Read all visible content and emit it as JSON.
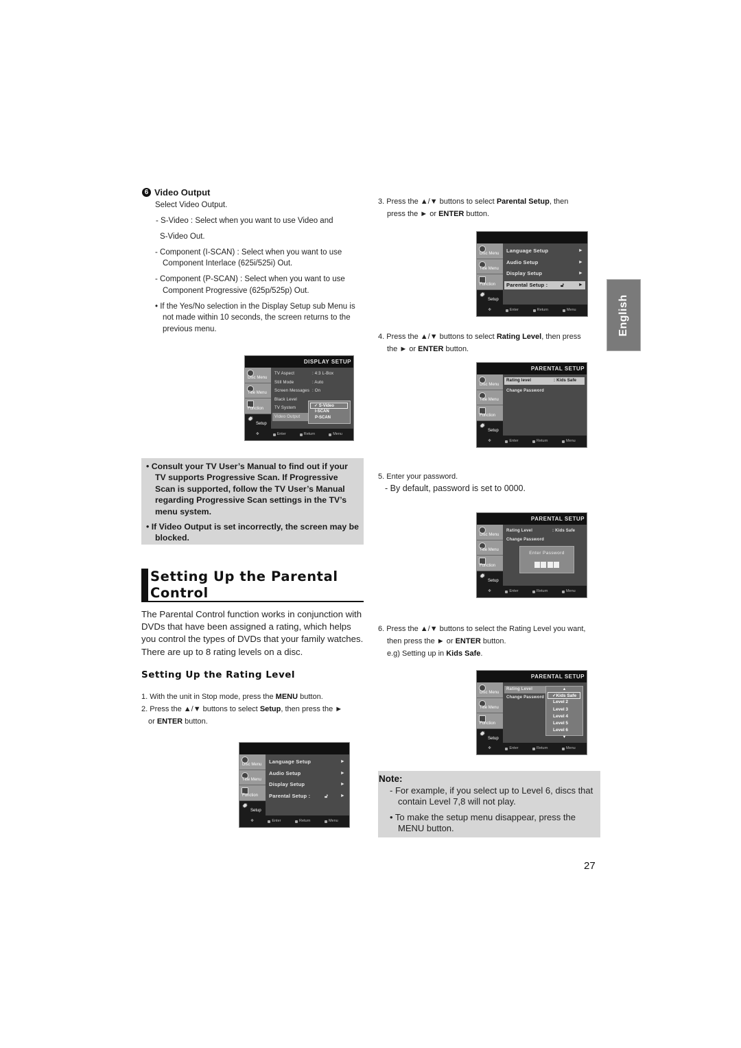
{
  "language_tab": "English",
  "page_number": "27",
  "video_output": {
    "number": "6",
    "title": "Video Output",
    "lines": [
      "Select Video Output.",
      "- S-Video : Select when you want to use Video and",
      "S-Video Out.",
      "- Component (I-SCAN) : Select when you want to use Component Interlace (625i/525i) Out.",
      "- Component (P-SCAN) : Select when you want to use Component Progressive (625p/525p) Out.",
      "• If the Yes/No selection in the Display Setup sub Menu is not made within 10 seconds, the screen returns to the previous menu."
    ]
  },
  "osd_common": {
    "side_tabs": [
      "Disc Menu",
      "Title Menu",
      "Function",
      "Setup"
    ],
    "bottom": [
      "Enter",
      "Return",
      "Menu"
    ]
  },
  "display_setup_screen": {
    "title": "DISPLAY SETUP",
    "rows": [
      {
        "label": "TV Aspect",
        "value": ": 4:3 L-Box"
      },
      {
        "label": "Still Mode",
        "value": ": Auto"
      },
      {
        "label": "Screen Messages",
        "value": ": On"
      },
      {
        "label": "Black Level",
        "value": ""
      },
      {
        "label": "TV System",
        "value": ""
      },
      {
        "label": "Video Output",
        "value": ""
      }
    ],
    "popup_options": [
      "S-Video",
      "I-SCAN",
      "P-SCAN"
    ],
    "popup_selected": "S-Video"
  },
  "notice": [
    "• Consult your TV User’s Manual to find out if your TV supports Progressive Scan. If Progressive Scan is supported, follow the TV User’s Manual regarding Progressive Scan settings in the TV’s menu system.",
    "• If Video Output is set incorrectly, the screen may be blocked."
  ],
  "section": {
    "title": "Setting Up the Parental Control",
    "intro": "The Parental Control function works in conjunction with DVDs that have been assigned a rating, which helps you control the types of DVDs that your family watches. There are up to 8 rating levels on a disc.",
    "subtitle": "Setting Up the Rating Level"
  },
  "steps": {
    "s1": {
      "pre": "1. With the unit in Stop mode, press the ",
      "bold": "MENU",
      "post": " button."
    },
    "s2": {
      "pre": "2. Press the ▲/▼ buttons to select ",
      "bold": "Setup",
      "mid": ", then press the ►",
      "cont_pre": "or ",
      "cont_bold": "ENTER",
      "cont_post": " button."
    },
    "s3": {
      "pre": "3. Press the ▲/▼ buttons to select ",
      "bold": "Parental Setup",
      "mid": ", then",
      "cont_pre": "press the ► or ",
      "cont_bold": "ENTER",
      "cont_post": " button."
    },
    "s4": {
      "pre": "4. Press the ▲/▼ buttons to select ",
      "bold": "Rating Level",
      "mid": ", then press",
      "cont_pre": "the ► or ",
      "cont_bold": "ENTER",
      "cont_post": " button."
    },
    "s5": {
      "line": "5. Enter your password.",
      "sub": "- By default, password is set to 0000."
    },
    "s6": {
      "line1": "6. Press the ▲/▼ buttons to select the Rating Level you want,",
      "cont_pre": "then press the ► or ",
      "cont_bold": "ENTER",
      "cont_post": " button.",
      "eg_pre": "e.g) Setting up in ",
      "eg_bold": "Kids Safe",
      "eg_post": "."
    }
  },
  "setup_menu_screen": {
    "rows": [
      "Language Setup",
      "Audio Setup",
      "Display Setup",
      "Parental Setup :"
    ],
    "arrow": "►",
    "highlighted": "Parental Setup :"
  },
  "parental_screen": {
    "title": "PARENTAL SETUP",
    "rating_label": "Rating level",
    "rating_label_2": "Rating Level",
    "rating_value": ": Kids Safe",
    "change_password": "Change Password",
    "enter_password": "Enter Password",
    "levels": [
      "Kids Safe",
      "Level 2",
      "Level 3",
      "Level 4",
      "Level 5",
      "Level 6"
    ],
    "selected_level": "Kids Safe"
  },
  "note": {
    "title": "Note:",
    "items": [
      "-  For example, if you select up to Level 6, discs that contain Level 7,8 will not play.",
      "• To make the setup menu disappear, press the MENU button."
    ]
  }
}
